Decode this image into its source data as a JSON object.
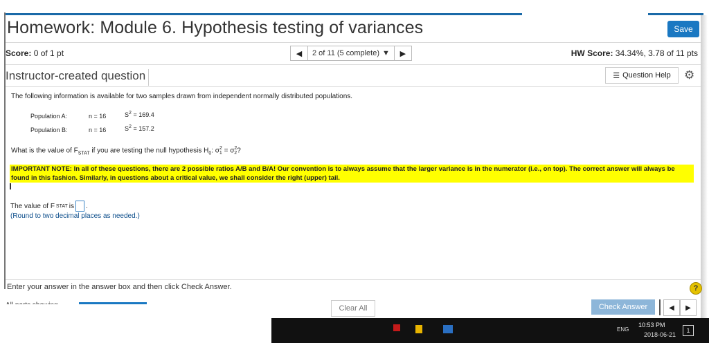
{
  "header": {
    "title": "Homework: Module 6. Hypothesis testing of variances",
    "save_label": "Save"
  },
  "scorebar": {
    "score_label": "Score:",
    "score_value": "0 of 1 pt",
    "nav_prev_icon": "triangle-left",
    "nav_select_label": "2 of 11 (5 complete)",
    "nav_next_icon": "triangle-right",
    "hw_label": "HW Score:",
    "hw_value": "34.34%, 3.78 of 11 pts"
  },
  "question_header": {
    "type_label": "Instructor-created question",
    "help_label": "Question Help",
    "gear_icon": "gear-icon"
  },
  "question": {
    "intro": "The following information is available for two samples drawn from independent normally distributed populations.",
    "populations": [
      {
        "label": "Population A:",
        "n": "n = 16",
        "s_prefix": "S",
        "s_exp": "2",
        "s_val": "= 169.4"
      },
      {
        "label": "Population B:",
        "n": "n = 16",
        "s_prefix": "S",
        "s_exp": "2",
        "s_val": "= 157.2"
      }
    ],
    "prompt_start": "What is the value of F",
    "prompt_sub": "STAT",
    "prompt_mid": " if you are testing the null hypothesis H",
    "prompt_h_sub": "0",
    "prompt_end": ": σ",
    "prompt_s1_sub": "1",
    "prompt_eq": " = σ",
    "prompt_s2_sub": "2",
    "prompt_q": "?",
    "sigma_exp": "2",
    "note": "IMPORTANT NOTE: In all of these questions, there are 2 possible ratios A/B  and B/A!  Our convention is to always assume that the larger variance is in the numerator (i.e., on top).  The correct answer will always be found in this fashion.  Similarly, in questions about a critical value, we shall consider the right (upper) tail.",
    "answer_prefix": "The value of F",
    "answer_sub": "STAT",
    "answer_is": " is",
    "answer_period": ".",
    "round_hint": "(Round to two decimal places as needed.)"
  },
  "footer": {
    "instruction": "Enter your answer in the answer box and then click Check Answer.",
    "help_symbol": "?",
    "all_parts_cut": "All parts showing",
    "clear_all": "Clear All",
    "check_answer": "Check Answer"
  },
  "taskbar": {
    "time": "10:53 PM",
    "date": "2018-06-21",
    "lang": "ENG",
    "notif": "1"
  },
  "colors": {
    "brand_blue": "#1a78c2",
    "highlight": "#ffff00",
    "check_disabled": "#8db6d9"
  }
}
